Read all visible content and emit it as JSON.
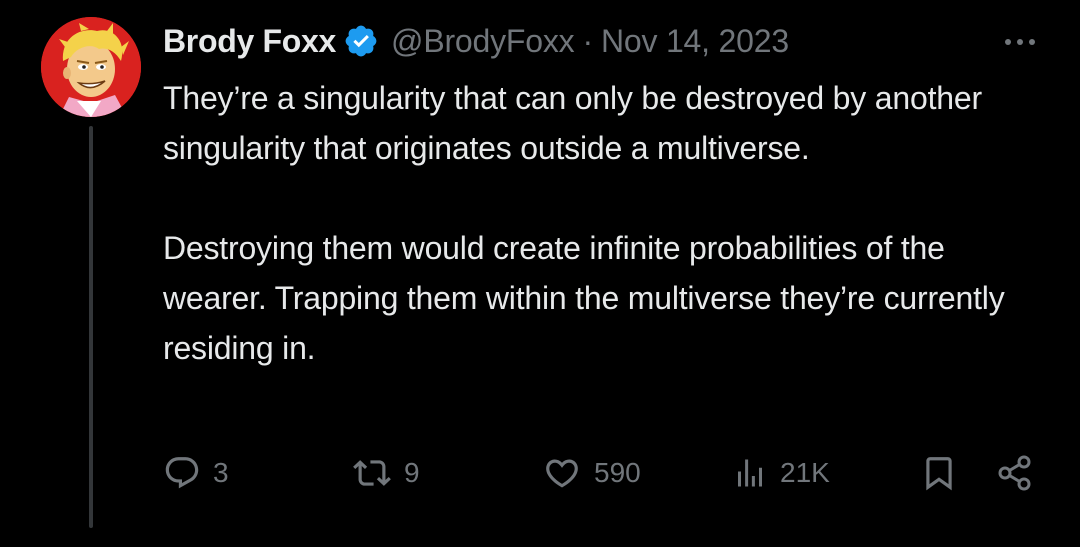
{
  "author": {
    "display_name": "Brody Foxx",
    "handle": "@BrodyFoxx",
    "separator": "·",
    "date": "Nov 14, 2023",
    "verified": true,
    "avatar_bg": "#d9221f"
  },
  "tweet": {
    "paragraphs": [
      "They’re a singularity that can only be destroyed by another singularity that originates outside a multiverse.",
      "Destroying them would create infinite probabilities of the wearer. Trapping them within the multiverse they’re currently residing in."
    ]
  },
  "actions": {
    "replies": "3",
    "reposts": "9",
    "likes": "590",
    "views": "21K"
  },
  "icons": {
    "verified": "verified-badge-icon",
    "more": "more-options-icon",
    "reply": "reply-icon",
    "repost": "repost-icon",
    "like": "heart-icon",
    "views": "views-chart-icon",
    "bookmark": "bookmark-icon",
    "share": "share-icon"
  },
  "colors": {
    "background": "#000000",
    "primary_text": "#e7e9ea",
    "secondary_text": "#71767b",
    "verified_blue": "#1d9bf0",
    "thread_line": "#333639"
  }
}
